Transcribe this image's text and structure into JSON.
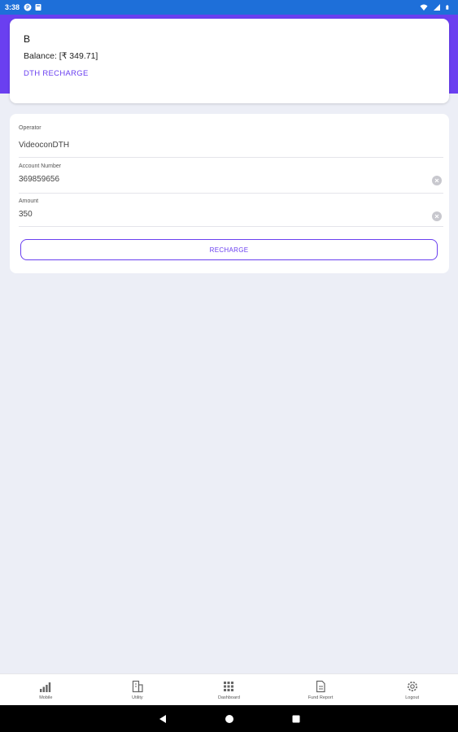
{
  "status_bar": {
    "time": "3:38",
    "left_icons": [
      "p-circle-icon",
      "card-icon"
    ],
    "right_icons": [
      "wifi-icon",
      "signal-icon",
      "battery-icon"
    ]
  },
  "header": {
    "user_name": "B",
    "balance_text": "Balance: [₹ 349.71]",
    "service_title": "DTH RECHARGE"
  },
  "form": {
    "operator": {
      "label": "Operator",
      "value": "VideoconDTH"
    },
    "account_number": {
      "label": "Account Number",
      "value": "369859656"
    },
    "amount": {
      "label": "Amount",
      "value": "350"
    },
    "submit_label": "RECHARGE"
  },
  "bottom_nav": [
    {
      "label": "Mobile",
      "icon": "signal-bars-icon"
    },
    {
      "label": "Utility",
      "icon": "building-icon"
    },
    {
      "label": "Dashboard",
      "icon": "grid-icon"
    },
    {
      "label": "Fund Report",
      "icon": "document-icon"
    },
    {
      "label": "Logout",
      "icon": "gear-icon"
    }
  ],
  "system_nav": [
    "back-icon",
    "home-icon",
    "recents-icon"
  ],
  "colors": {
    "status_bar": "#1e6fd9",
    "accent": "#6a3ff0",
    "background": "#eceef6"
  }
}
